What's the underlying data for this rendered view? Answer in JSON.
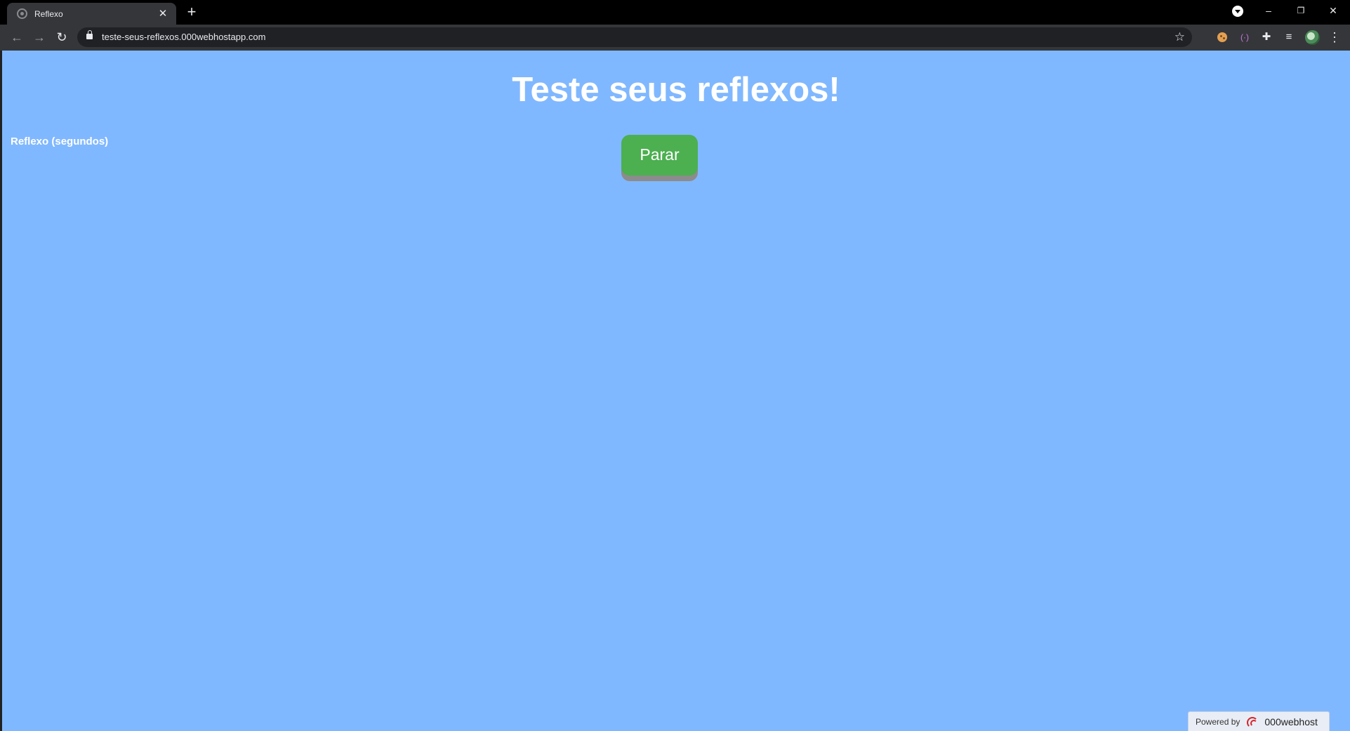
{
  "browser": {
    "tab_title": "Reflexo",
    "tab_close": "✕",
    "new_tab": "+",
    "url": "teste-seus-reflexos.000webhostapp.com",
    "controls": {
      "minimize": "–",
      "restore": "❐",
      "close": "✕"
    },
    "nav": {
      "back": "←",
      "forward": "→",
      "reload": "↻"
    },
    "star": "☆",
    "extensions": {
      "broadcast": "(·)",
      "puzzle": "✚",
      "playlist": "≡",
      "menu": "⋮"
    }
  },
  "page": {
    "background": "#80b8ff",
    "title": "Teste seus reflexos!",
    "reflex_label": "Reflexo (segundos)",
    "stop_button": "Parar",
    "stop_button_color": "#4caf50"
  },
  "footer": {
    "powered_by": "Powered by",
    "brand": "000webhost"
  }
}
